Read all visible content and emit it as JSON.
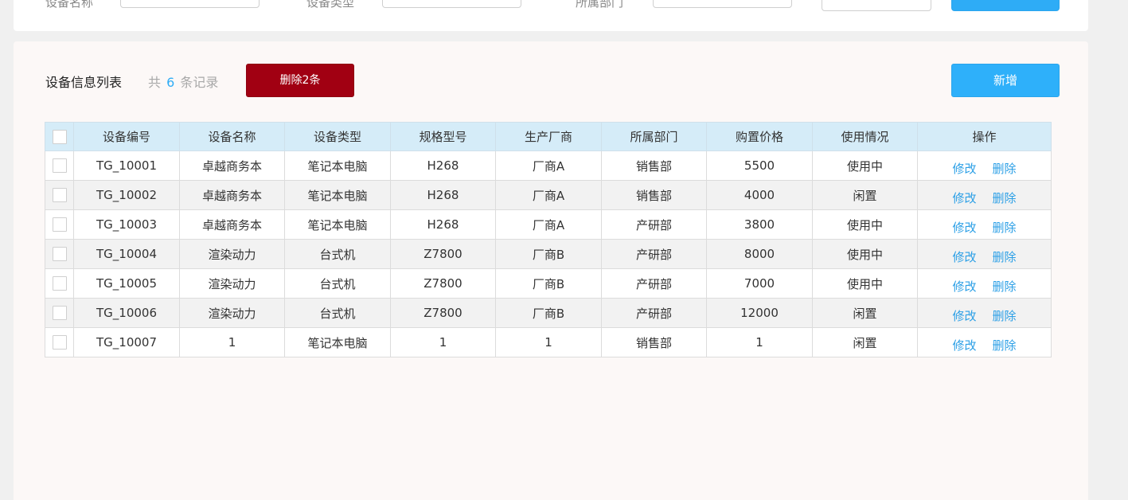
{
  "filters": {
    "name_label": "设备名称",
    "type_label": "设备类型",
    "dept_label": "所属部门",
    "reset_label": "",
    "query_label": ""
  },
  "list": {
    "title": "设备信息列表",
    "count_prefix": "共",
    "count": "6",
    "count_suffix": "条记录",
    "delete_batch_label": "删除2条",
    "add_label": "新增"
  },
  "table": {
    "columns": [
      "设备编号",
      "设备名称",
      "设备类型",
      "规格型号",
      "生产厂商",
      "所属部门",
      "购置价格",
      "使用情况",
      "操作"
    ],
    "edit_label": "修改",
    "delete_label": "删除",
    "rows": [
      {
        "id": "TG_10001",
        "name": "卓越商务本",
        "type": "笔记本电脑",
        "model": "H268",
        "maker": "厂商A",
        "dept": "销售部",
        "price": "5500",
        "status": "使用中"
      },
      {
        "id": "TG_10002",
        "name": "卓越商务本",
        "type": "笔记本电脑",
        "model": "H268",
        "maker": "厂商A",
        "dept": "销售部",
        "price": "4000",
        "status": "闲置"
      },
      {
        "id": "TG_10003",
        "name": "卓越商务本",
        "type": "笔记本电脑",
        "model": "H268",
        "maker": "厂商A",
        "dept": "产研部",
        "price": "3800",
        "status": "使用中"
      },
      {
        "id": "TG_10004",
        "name": "渲染动力",
        "type": "台式机",
        "model": "Z7800",
        "maker": "厂商B",
        "dept": "产研部",
        "price": "8000",
        "status": "使用中"
      },
      {
        "id": "TG_10005",
        "name": "渲染动力",
        "type": "台式机",
        "model": "Z7800",
        "maker": "厂商B",
        "dept": "产研部",
        "price": "7000",
        "status": "使用中"
      },
      {
        "id": "TG_10006",
        "name": "渲染动力",
        "type": "台式机",
        "model": "Z7800",
        "maker": "厂商B",
        "dept": "产研部",
        "price": "12000",
        "status": "闲置"
      },
      {
        "id": "TG_10007",
        "name": "1",
        "type": "笔记本电脑",
        "model": "1",
        "maker": "1",
        "dept": "销售部",
        "price": "1",
        "status": "闲置"
      }
    ]
  },
  "colors": {
    "accent": "#2eb0fa",
    "danger": "#a10012",
    "header_bg": "#d5ecf8",
    "link": "#2b9fe6"
  }
}
